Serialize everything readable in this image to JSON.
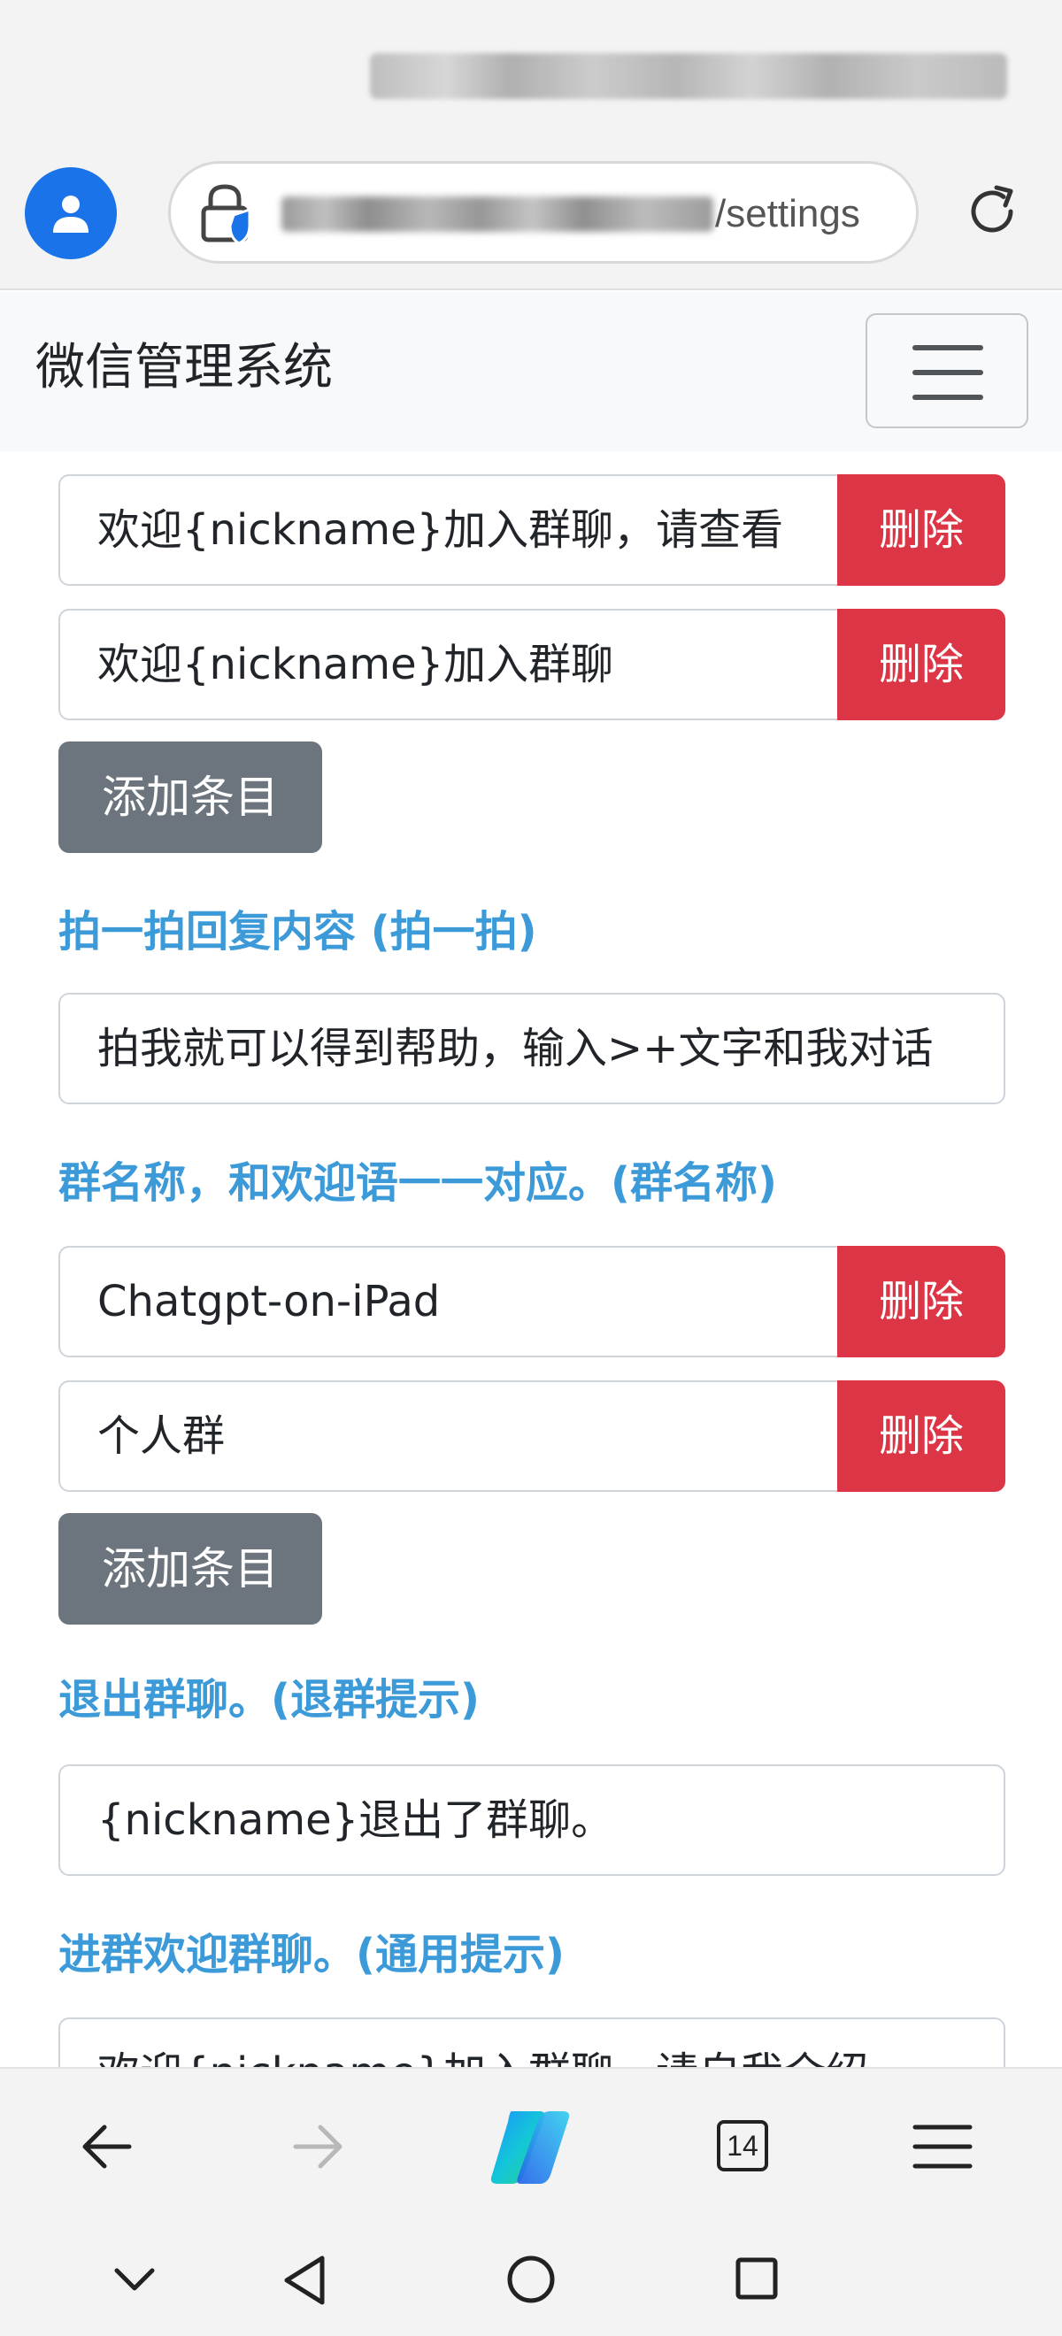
{
  "browser": {
    "url_suffix": "/settings",
    "tab_count": "14"
  },
  "navbar": {
    "brand": "微信管理系统"
  },
  "welcome_entries": [
    {
      "value": "欢迎{nickname}加入群聊，请查看",
      "delete_label": "删除"
    },
    {
      "value": "欢迎{nickname}加入群聊",
      "delete_label": "删除"
    }
  ],
  "add_button_1": "添加条目",
  "pat_section": {
    "label": "拍一拍回复内容 (拍一拍)",
    "value": "拍我就可以得到帮助，输入>+文字和我对话"
  },
  "group_names_section": {
    "label": "群名称，和欢迎语一一对应。(群名称)",
    "entries": [
      {
        "value": "Chatgpt-on-iPad",
        "delete_label": "删除"
      },
      {
        "value": "个人群",
        "delete_label": "删除"
      }
    ]
  },
  "add_button_2": "添加条目",
  "leave_section": {
    "label": "退出群聊。(退群提示)",
    "value": "{nickname}退出了群聊。"
  },
  "general_section": {
    "label": "进群欢迎群聊。(通用提示)",
    "value": "欢迎{nickname}加入群聊，请自我介绍"
  }
}
